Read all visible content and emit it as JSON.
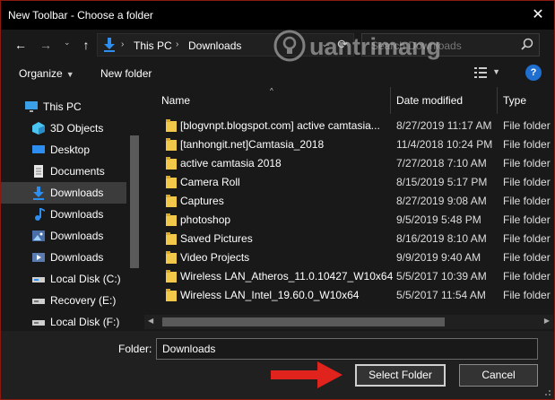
{
  "window": {
    "title": "New Toolbar - Choose a folder",
    "close_glyph": "✕",
    "border_color": "#8a1a10"
  },
  "nav": {
    "back_glyph": "←",
    "forward_glyph": "→",
    "up_glyph": "↑",
    "dropdown_glyph": "⌄",
    "refresh_glyph": "⟳",
    "breadcrumb": [
      "This PC",
      "Downloads"
    ],
    "search_placeholder": "Search Downloads"
  },
  "watermark": {
    "text": "uantrimang"
  },
  "toolbar": {
    "organize_label": "Organize",
    "new_folder_label": "New folder",
    "help_glyph": "?"
  },
  "sidebar": {
    "items": [
      {
        "label": "This PC",
        "icon": "pc-icon"
      },
      {
        "label": "3D Objects",
        "icon": "cube-icon"
      },
      {
        "label": "Desktop",
        "icon": "desktop-icon"
      },
      {
        "label": "Documents",
        "icon": "document-icon"
      },
      {
        "label": "Downloads",
        "icon": "download-icon"
      },
      {
        "label": "Downloads",
        "icon": "music-icon"
      },
      {
        "label": "Downloads",
        "icon": "pictures-icon"
      },
      {
        "label": "Downloads",
        "icon": "video-icon"
      },
      {
        "label": "Local Disk (C:)",
        "icon": "drive-icon"
      },
      {
        "label": "Recovery (E:)",
        "icon": "drive-icon"
      },
      {
        "label": "Local Disk (F:)",
        "icon": "drive-icon"
      }
    ],
    "selected_index": 4
  },
  "files": {
    "columns": [
      "Name",
      "Date modified",
      "Type"
    ],
    "rows": [
      {
        "name": "[blogvnpt.blogspot.com] active camtasia...",
        "date": "8/27/2019 11:17 AM",
        "type": "File folder"
      },
      {
        "name": "[tanhongit.net]Camtasia_2018",
        "date": "11/4/2018 10:24 PM",
        "type": "File folder"
      },
      {
        "name": "active camtasia 2018",
        "date": "7/27/2018 7:10 AM",
        "type": "File folder"
      },
      {
        "name": "Camera Roll",
        "date": "8/15/2019 5:17 PM",
        "type": "File folder"
      },
      {
        "name": "Captures",
        "date": "8/27/2019 9:08 AM",
        "type": "File folder"
      },
      {
        "name": "photoshop",
        "date": "9/5/2019 5:48 PM",
        "type": "File folder"
      },
      {
        "name": "Saved Pictures",
        "date": "8/16/2019 8:10 AM",
        "type": "File folder"
      },
      {
        "name": "Video Projects",
        "date": "9/9/2019 9:40 AM",
        "type": "File folder"
      },
      {
        "name": "Wireless LAN_Atheros_11.0.10427_W10x64",
        "date": "5/5/2017 10:39 AM",
        "type": "File folder"
      },
      {
        "name": "Wireless LAN_Intel_19.60.0_W10x64",
        "date": "5/5/2017 11:54 AM",
        "type": "File folder"
      }
    ]
  },
  "footer": {
    "folder_label": "Folder:",
    "folder_value": "Downloads",
    "select_label": "Select Folder",
    "cancel_label": "Cancel"
  },
  "colors": {
    "accent_blue": "#1f6fd1",
    "folder_yellow": "#f2c84b",
    "arrow_red": "#e0231c"
  }
}
